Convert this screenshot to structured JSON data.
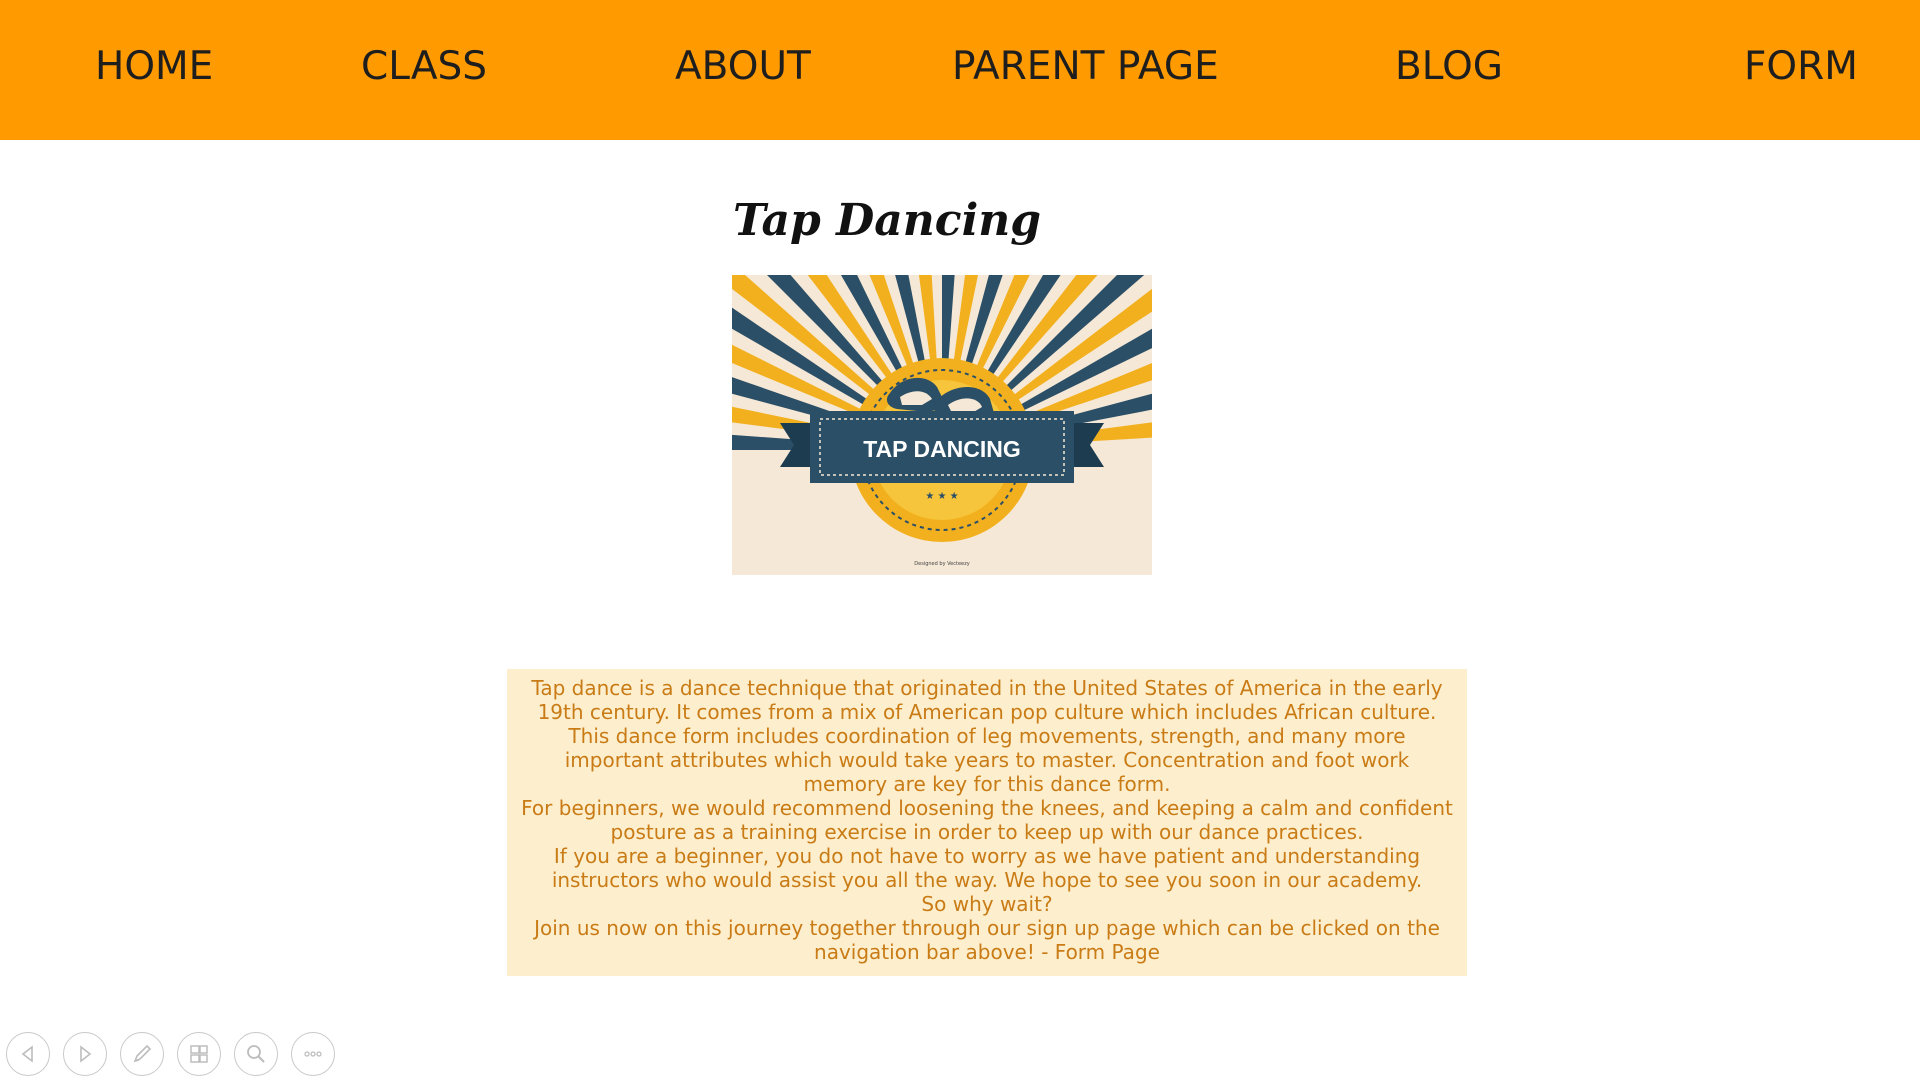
{
  "nav": {
    "items": [
      {
        "label": "HOME"
      },
      {
        "label": "CLASS"
      },
      {
        "label": "ABOUT"
      },
      {
        "label": "PARENT PAGE"
      },
      {
        "label": "BLOG"
      },
      {
        "label": "FORM"
      }
    ]
  },
  "page": {
    "title": "Tap Dancing"
  },
  "hero": {
    "banner_text": "TAP DANCING",
    "credit": "Designed by Vecteezy"
  },
  "content": {
    "paragraphs": [
      "Tap dance is a dance technique that originated in the United States of America in the early 19th century. It comes from a mix of American pop culture which includes African culture.",
      "This dance form includes coordination of leg movements, strength, and many more important attributes which would take years to master. Concentration and foot work memory are key for this dance form.",
      "For beginners, we would recommend loosening the knees, and keeping a calm and confident posture as a training exercise in order to keep up with our dance practices.",
      "If you are a beginner, you do not have to worry as we have patient and understanding instructors who would assist you all the way. We hope to see you soon in our academy.",
      "So why wait?",
      "Join us now on this journey together through our sign up page which can be clicked on the navigation bar above! - Form Page"
    ]
  },
  "controls": {
    "icons": [
      "previous-icon",
      "next-icon",
      "pen-icon",
      "slides-icon",
      "zoom-icon",
      "more-icon"
    ]
  },
  "colors": {
    "nav_background": "#ff9a00",
    "text_box_background": "#fdefcd",
    "text_color": "#c97b16",
    "hero_gold": "#f2b01e",
    "hero_navy": "#2b4f66"
  }
}
